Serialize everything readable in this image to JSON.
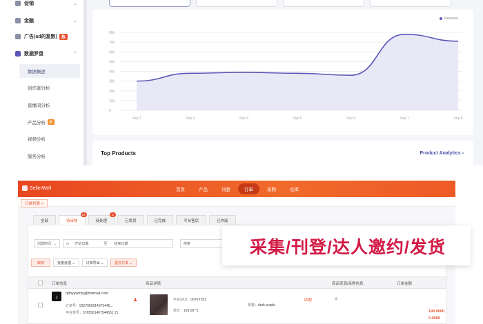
{
  "sidebar": {
    "items": [
      {
        "label": "促销",
        "top": -4
      },
      {
        "label": "金融",
        "top": 21
      },
      {
        "label": "广告(ad的复数)",
        "badge": "热",
        "top": 44
      },
      {
        "label": "数据罗盘",
        "top": 69
      }
    ],
    "subitems": [
      {
        "label": "数据概述",
        "active": true
      },
      {
        "label": "创作者分析"
      },
      {
        "label": "直播间分析"
      },
      {
        "label": "产品分析",
        "new": "新"
      },
      {
        "label": "视频分析"
      },
      {
        "label": "服务分析"
      }
    ]
  },
  "chart": {
    "legend": "Revenue",
    "yticks": [
      "80k",
      "70k",
      "60k",
      "50k",
      "40k",
      "30k",
      "20k",
      "10k",
      "0"
    ],
    "xticks": [
      "Sep 2",
      "Sep 3",
      "Sep 4",
      "Sep 5",
      "Sep 6",
      "Sep 7",
      "Sep 8"
    ]
  },
  "chart_data": {
    "type": "area",
    "x": [
      "Sep 2",
      "Sep 3",
      "Sep 4",
      "Sep 5",
      "Sep 6",
      "Sep 7",
      "Sep 8"
    ],
    "series": [
      {
        "name": "Revenue",
        "values": [
          30,
          38,
          39,
          38,
          36,
          78,
          71
        ],
        "color": "#5a56b8"
      }
    ],
    "ylim": [
      0,
      80
    ],
    "grid": true,
    "legend": "top-right"
  },
  "products": {
    "title": "Top Products",
    "link": "Product Analytics",
    "link_arrow": "›"
  },
  "erp": {
    "logo": "SellerWell",
    "nav": [
      {
        "label": "首页"
      },
      {
        "label": "产品"
      },
      {
        "label": "刊登"
      },
      {
        "label": "订单",
        "active": true
      },
      {
        "label": "采购"
      },
      {
        "label": "仓库"
      }
    ],
    "subtab": "订单列表 ×",
    "tabs": [
      {
        "label": "全部"
      },
      {
        "label": "待审核",
        "count": "10",
        "selected": true
      },
      {
        "label": "待处理",
        "count": "2"
      },
      {
        "label": "已发货"
      },
      {
        "label": "已完成"
      },
      {
        "label": "平台售后"
      },
      {
        "label": "已作废"
      }
    ],
    "filters": {
      "date_select": "创建时间",
      "start": "开始日期",
      "sep": "至",
      "end": "结束日期",
      "search": "搜索"
    },
    "actions": {
      "primary": "审核",
      "batch": "批量处理 ⌄",
      "export": "订单导出 ⌄",
      "more": "提交订单 ⌄"
    },
    "headers": {
      "order_info": "订单信息",
      "product_detail": "商品详情",
      "source": "商品来源/采购信息",
      "amount": "订单金额"
    },
    "order": {
      "platform_icon": "♪",
      "email": "njfbyywtcty@hotmail.com",
      "order_no_label": "订单号：",
      "order_no": "5957065614075445...",
      "platform_label": "平台单号：",
      "platform_no": "5765561407544551 21",
      "sku_label": "平台SKU：",
      "sku": "007FT201",
      "spec_label": "规格：",
      "spec": "dark purple",
      "price_label": "单价：",
      "price": "199.00 *1",
      "match": "匹配",
      "amount1": "199.0000",
      "amount2": "0.0000"
    }
  },
  "banner": {
    "text": "采集/刊登/达人邀约/发货"
  }
}
